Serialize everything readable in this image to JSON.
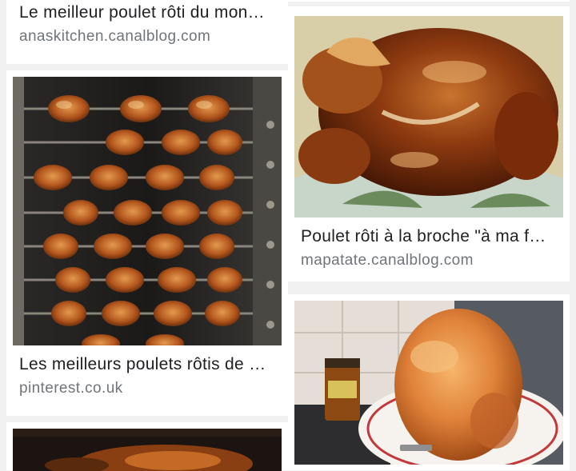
{
  "results": [
    {
      "title": "Le meilleur poulet rôti du mon…",
      "source": "anaskitchen.canalblog.com",
      "image": "roast-chicken-photo"
    },
    {
      "title": "Poulet rôti à la broche \"à ma f…",
      "source": "mapatate.canalblog.com",
      "image": "spit-roasted-chicken-photo"
    },
    {
      "title": "Les meilleurs poulets rôtis de …",
      "source": "pinterest.co.uk",
      "image": "rotisserie-rack-photo"
    },
    {
      "image": "roast-chicken-partial-photo"
    },
    {
      "image": "seasoned-chicken-on-plate-photo"
    }
  ]
}
